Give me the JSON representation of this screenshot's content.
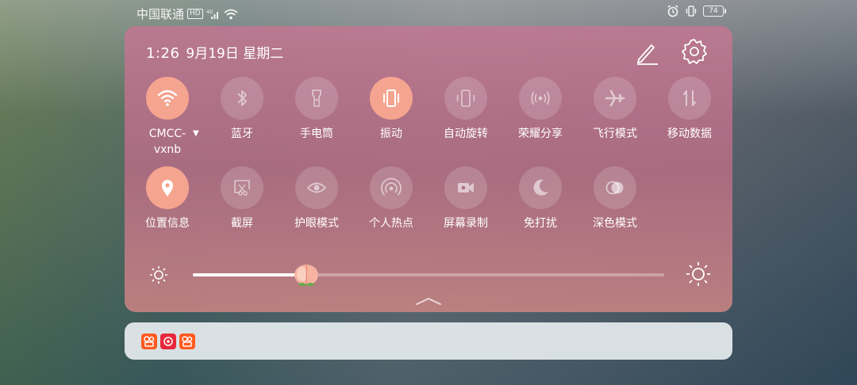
{
  "status_bar": {
    "carrier": "中国联通",
    "hd": "HD",
    "battery": "74"
  },
  "panel": {
    "time": "1:26",
    "date": "9月19日 星期二"
  },
  "tiles_row1": [
    {
      "label": "CMCC-\nvxnb",
      "icon": "wifi-icon",
      "on": true
    },
    {
      "label": "蓝牙",
      "icon": "bluetooth-icon",
      "on": false
    },
    {
      "label": "手电筒",
      "icon": "flashlight-icon",
      "on": false
    },
    {
      "label": "振动",
      "icon": "vibrate-icon",
      "on": true
    },
    {
      "label": "自动旋转",
      "icon": "auto-rotate-icon",
      "on": false
    },
    {
      "label": "荣耀分享",
      "icon": "share-icon",
      "on": false
    },
    {
      "label": "飞行模式",
      "icon": "airplane-icon",
      "on": false
    },
    {
      "label": "移动数据",
      "icon": "mobile-data-icon",
      "on": false
    }
  ],
  "tiles_row2": [
    {
      "label": "位置信息",
      "icon": "location-icon",
      "on": true
    },
    {
      "label": "截屏",
      "icon": "screenshot-icon",
      "on": false
    },
    {
      "label": "护眼模式",
      "icon": "eye-icon",
      "on": false
    },
    {
      "label": "个人热点",
      "icon": "hotspot-icon",
      "on": false
    },
    {
      "label": "屏幕录制",
      "icon": "screen-record-icon",
      "on": false
    },
    {
      "label": "免打扰",
      "icon": "moon-icon",
      "on": false
    },
    {
      "label": "深色模式",
      "icon": "dark-mode-icon",
      "on": false
    }
  ],
  "brightness": {
    "level": 0.24
  },
  "notification_apps": [
    {
      "icon": "kuaishou-icon",
      "color": "#ff5a1f"
    },
    {
      "icon": "live-app-icon",
      "color": "#e8283c"
    },
    {
      "icon": "kuaishou-icon",
      "color": "#ff5a1f"
    }
  ],
  "colors": {
    "tile_on": "#f5a48f",
    "panel": "#b97890"
  }
}
